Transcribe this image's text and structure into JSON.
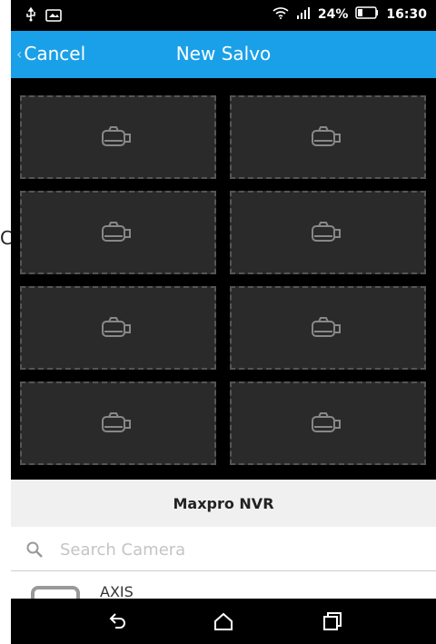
{
  "status_bar": {
    "battery": "24%",
    "time": "16:30",
    "icons": [
      "usb-icon",
      "image-icon",
      "wifi-icon",
      "signal-icon",
      "battery-icon"
    ]
  },
  "header": {
    "cancel_label": "Cancel",
    "title": "New Salvo",
    "accent": "#1aa0e8"
  },
  "slots": [
    {
      "icon": "camera-icon"
    },
    {
      "icon": "camera-icon"
    },
    {
      "icon": "camera-icon"
    },
    {
      "icon": "camera-icon"
    },
    {
      "icon": "camera-icon"
    },
    {
      "icon": "camera-icon"
    },
    {
      "icon": "camera-icon"
    },
    {
      "icon": "camera-icon"
    }
  ],
  "camera_list": {
    "group_title": "Maxpro NVR",
    "search_placeholder": "Search Camera",
    "items": [
      {
        "label": "AXIS"
      }
    ]
  },
  "stray_text": "C",
  "nav": [
    "back-icon",
    "home-icon",
    "recents-icon"
  ]
}
